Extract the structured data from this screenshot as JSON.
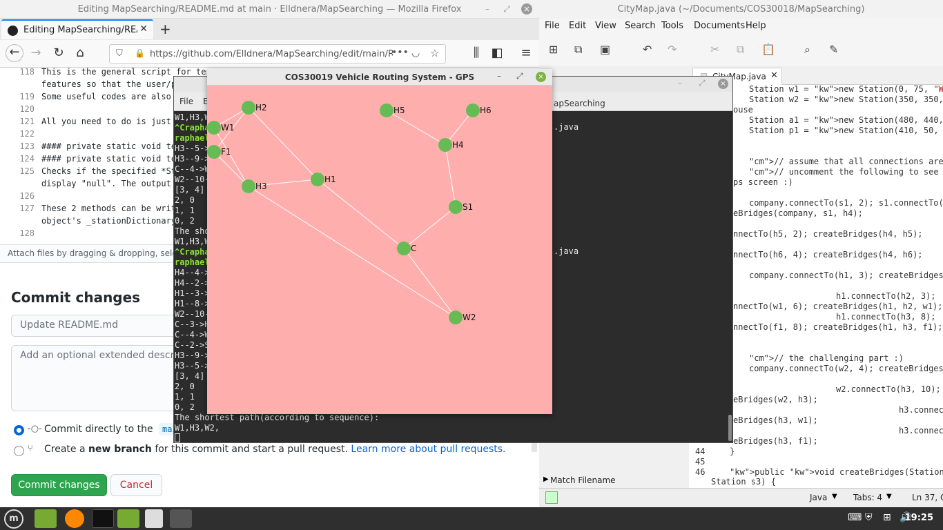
{
  "firefox": {
    "window_title": "Editing MapSearching/README.md at main · Elldnera/MapSearching — Mozilla Firefox",
    "tab_title": "Editing MapSearching/READM",
    "url": "https://github.com/Elldnera/MapSearching/edit/main/REA",
    "code_lines": [
      {
        "n": "118",
        "text": "This is the general script for tes"
      },
      {
        "n": "",
        "text": "features so that the user/p"
      },
      {
        "n": "119",
        "text": "Some useful codes are also"
      },
      {
        "n": "120",
        "text": ""
      },
      {
        "n": "121",
        "text": "All you need to do is just"
      },
      {
        "n": "122",
        "text": ""
      },
      {
        "n": "123",
        "text": "#### private static void te"
      },
      {
        "n": "124",
        "text": "#### private static void te"
      },
      {
        "n": "125",
        "text": "Checks if the specified *St"
      },
      {
        "n": "",
        "text": "display \"null\". The output"
      },
      {
        "n": "126",
        "text": ""
      },
      {
        "n": "127",
        "text": "These 2 methods can be writ"
      },
      {
        "n": "",
        "text": "object's _stationDictionary"
      },
      {
        "n": "128",
        "text": ""
      }
    ],
    "attach_text": "Attach files by dragging & dropping, selec",
    "commit_heading": "Commit changes",
    "commit_summary_placeholder": "Update README.md",
    "commit_desc_placeholder": "Add an optional extended descriptio",
    "radio_direct_pre": "Commit directly to the",
    "radio_direct_branch": "main",
    "radio_direct_post": "b",
    "radio_new_pre": "Create a",
    "radio_new_bold": "new branch",
    "radio_new_post": "for this commit and start a pull request.",
    "radio_new_link": "Learn more about pull requests.",
    "commit_button": "Commit changes",
    "cancel_button": "Cancel"
  },
  "gedit": {
    "window_title": "CityMap.java (~/Documents/COS30018/MapSearching)",
    "menu": [
      "File",
      "Edit",
      "View",
      "Search",
      "Tools",
      "Documents",
      "Help"
    ],
    "tab_label": "CityMap.java",
    "side_label": "apSearching",
    "side_items": [
      ".java",
      ".java"
    ],
    "match_filename": "Match Filename",
    "status_lang": "Java",
    "status_tabs": "Tabs: 4",
    "status_pos": "Ln 37, Co"
  },
  "terminal": {
    "menu_file": "File",
    "menu_e": "E",
    "lines": [
      {
        "t": "W1,H3,W",
        "g": false
      },
      {
        "t": "^Crapha",
        "g": true
      },
      {
        "t": "raphael",
        "g": true
      },
      {
        "t": "H3--5->",
        "g": false
      },
      {
        "t": "H3--9->",
        "g": false
      },
      {
        "t": "C--4->W",
        "g": false
      },
      {
        "t": "W2--10-",
        "g": false
      },
      {
        "t": "[3, 4]",
        "g": false
      },
      {
        "t": "2, 0",
        "g": false
      },
      {
        "t": "1, 1",
        "g": false
      },
      {
        "t": "0, 2",
        "g": false
      },
      {
        "t": "The sho",
        "g": false
      },
      {
        "t": "W1,H3,W",
        "g": false
      },
      {
        "t": "^Crapha",
        "g": true
      },
      {
        "t": "raphael",
        "g": true
      },
      {
        "t": "H4--4->",
        "g": false
      },
      {
        "t": "H4--2->",
        "g": false
      },
      {
        "t": "H1--3->",
        "g": false
      },
      {
        "t": "H1--8->",
        "g": false
      },
      {
        "t": "W2--10-",
        "g": false
      },
      {
        "t": "C--3->H",
        "g": false
      },
      {
        "t": "C--4->W",
        "g": false
      },
      {
        "t": "C--2->S",
        "g": false
      },
      {
        "t": "H3--9->",
        "g": false
      },
      {
        "t": "H3--5->",
        "g": false
      },
      {
        "t": "[3, 4]",
        "g": false
      },
      {
        "t": "2, 0",
        "g": false
      },
      {
        "t": "1, 1",
        "g": false
      },
      {
        "t": "0, 2",
        "g": false
      },
      {
        "t": "The shortest path(according to sequence):",
        "g": false
      },
      {
        "t": "W1,H3,W2,",
        "g": false
      }
    ]
  },
  "gps": {
    "title": "COS30019 Vehicle Routing System - GPS",
    "node_color": "#66bb55",
    "bg_color": "#ffaeae",
    "nodes": [
      {
        "id": "H2",
        "label": "H2"
      },
      {
        "id": "W1",
        "label": "W1"
      },
      {
        "id": "F1",
        "label": "F1"
      },
      {
        "id": "H3",
        "label": "H3"
      },
      {
        "id": "H1",
        "label": "H1"
      },
      {
        "id": "H5",
        "label": "H5"
      },
      {
        "id": "H6",
        "label": "H6"
      },
      {
        "id": "H4",
        "label": "H4"
      },
      {
        "id": "S1",
        "label": "S1"
      },
      {
        "id": "C",
        "label": "C"
      },
      {
        "id": "W2",
        "label": "W2"
      }
    ]
  },
  "taskbar": {
    "clock": "19:25"
  }
}
